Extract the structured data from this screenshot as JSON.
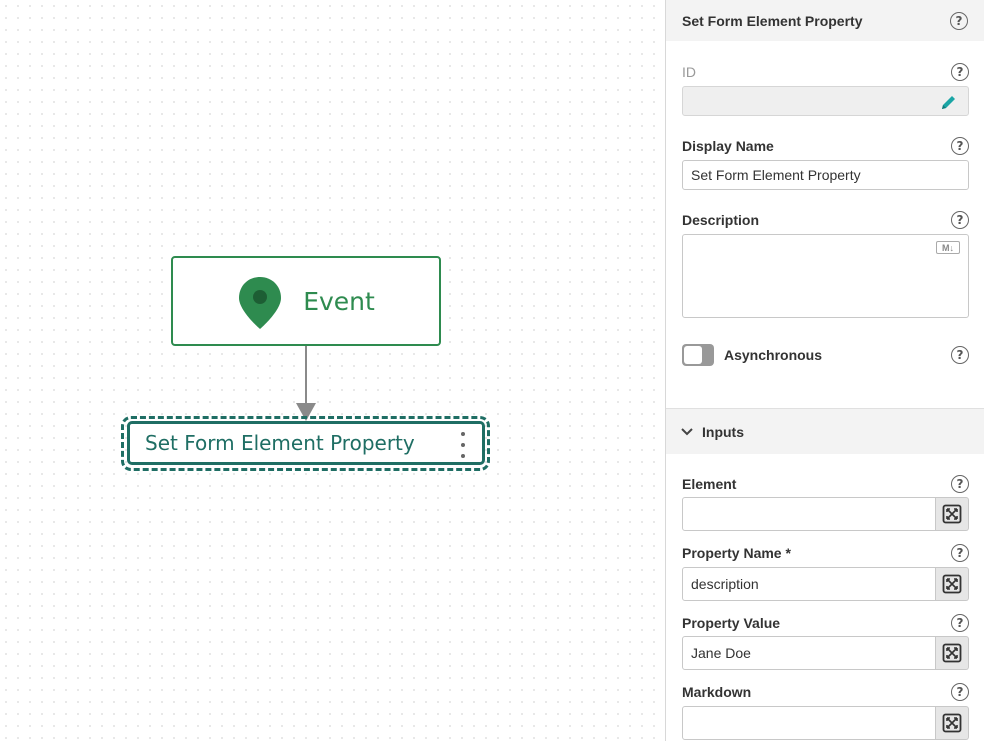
{
  "canvas": {
    "event_node": {
      "label": "Event",
      "color": "#2e8b4f",
      "icon": "map-pin-icon"
    },
    "step_node": {
      "label": "Set Form Element Property",
      "color": "#1f6e64",
      "menu_icon": "kebab-menu-icon"
    }
  },
  "panel": {
    "title": "Set Form Element Property",
    "id_field": {
      "label": "ID",
      "value": "",
      "edit_icon": "pencil-icon",
      "accent": "#1aa5a5"
    },
    "display_name": {
      "label": "Display Name",
      "value": "Set Form Element Property"
    },
    "description": {
      "label": "Description",
      "value": "",
      "badge": "M↓"
    },
    "asynchronous": {
      "label": "Asynchronous"
    },
    "inputs_section": {
      "title": "Inputs"
    },
    "inputs": [
      {
        "label": "Element",
        "value": ""
      },
      {
        "label": "Property Name *",
        "value": "description"
      },
      {
        "label": "Property Value",
        "value": "Jane Doe"
      },
      {
        "label": "Markdown",
        "value": ""
      }
    ],
    "help_glyph": "?"
  }
}
